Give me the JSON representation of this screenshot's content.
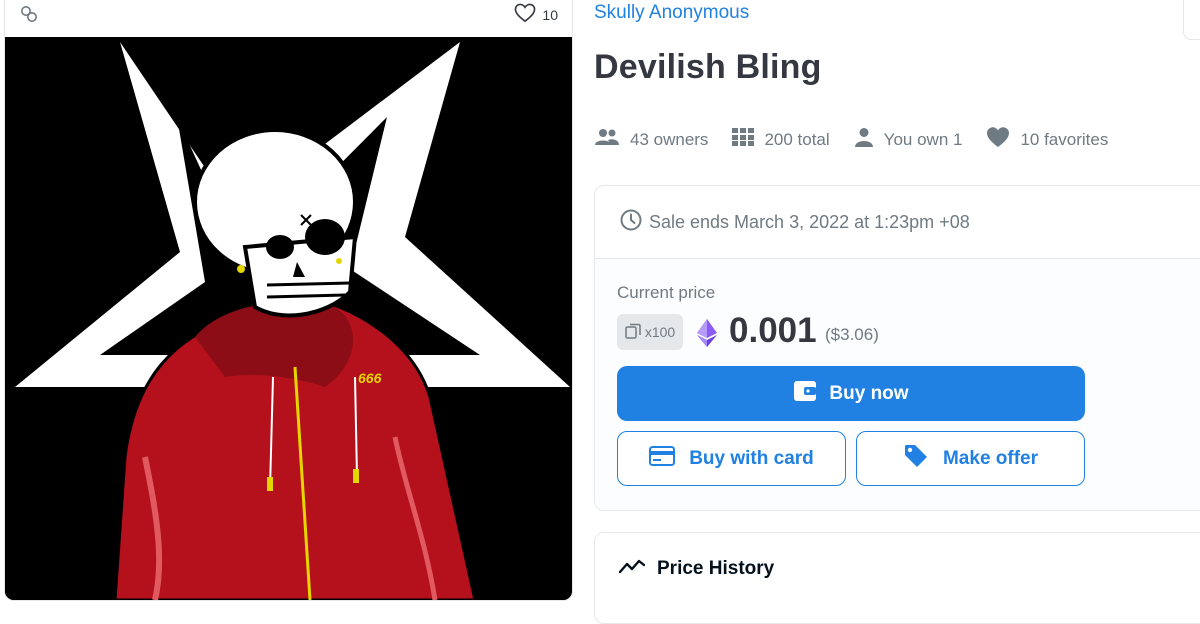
{
  "item": {
    "favorite_count": "10",
    "collection": "Skully Anonymous",
    "title": "Devilish Bling",
    "artwork_text": "666"
  },
  "stats": {
    "owners": "43 owners",
    "total": "200 total",
    "you_own": "You own 1",
    "favorites": "10 favorites"
  },
  "sale": {
    "ends": "Sale ends March 3, 2022 at 1:23pm +08",
    "price_label": "Current price",
    "quantity": "x100",
    "price": "0.001",
    "price_usd": "($3.06)",
    "buy_now": "Buy now",
    "buy_with_card": "Buy with card",
    "make_offer": "Make offer"
  },
  "price_history": {
    "title": "Price History"
  },
  "colors": {
    "accent": "#2081e2",
    "text": "#353840",
    "muted": "#707a83",
    "border": "#e5e8eb",
    "eth": "#627eea",
    "hoodie": "#b4111c"
  },
  "icons": {
    "chain": "link-chain-icon",
    "heart": "heart-icon",
    "owners": "people-icon",
    "total": "grid-icon",
    "you_own": "person-icon",
    "favorites": "heart-filled-icon",
    "clock": "clock-icon",
    "copies": "copies-icon",
    "ethereum": "ethereum-icon",
    "wallet": "wallet-icon",
    "card": "credit-card-icon",
    "tag": "tag-icon",
    "trend": "trend-icon"
  }
}
